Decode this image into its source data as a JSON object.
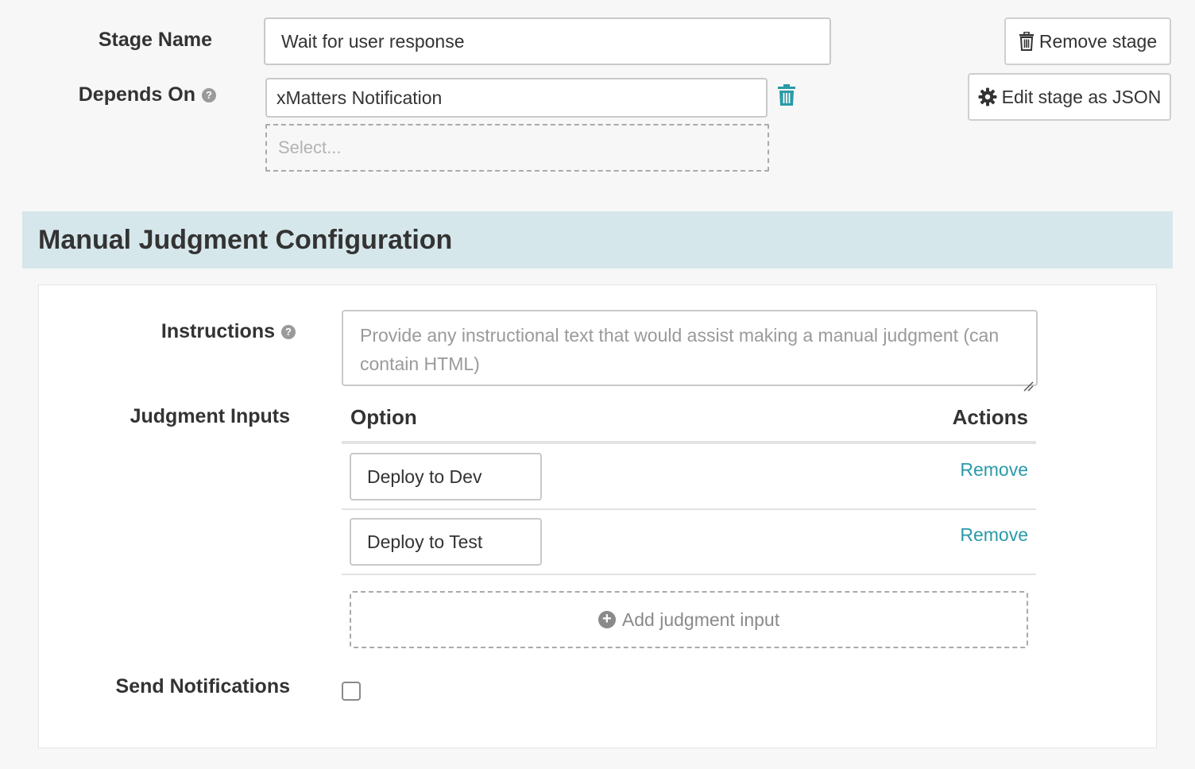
{
  "stage": {
    "name_label": "Stage Name",
    "name_value": "Wait for user response",
    "depends_label": "Depends On",
    "depends_value": "xMatters Notification",
    "select_placeholder": "Select...",
    "remove_stage_label": "Remove stage",
    "edit_json_label": "Edit stage as JSON"
  },
  "section": {
    "title": "Manual Judgment Configuration"
  },
  "instructions": {
    "label": "Instructions",
    "placeholder": "Provide any instructional text that would assist making a manual judgment (can contain HTML)"
  },
  "judgment_inputs": {
    "label": "Judgment Inputs",
    "col_option": "Option",
    "col_actions": "Actions",
    "rows": [
      {
        "value": "Deploy to Dev",
        "action": "Remove"
      },
      {
        "value": "Deploy to Test",
        "action": "Remove"
      }
    ],
    "add_label": "Add judgment input"
  },
  "notifications": {
    "label": "Send Notifications",
    "checked": false
  },
  "icons": {
    "help": "question-circle-icon",
    "trash": "trash-icon",
    "gear": "gear-icon",
    "plus": "plus-circle-icon"
  },
  "colors": {
    "accent": "#2a9aa8",
    "section_header_bg": "#d6e7eb",
    "page_bg": "#f7f7f7"
  }
}
